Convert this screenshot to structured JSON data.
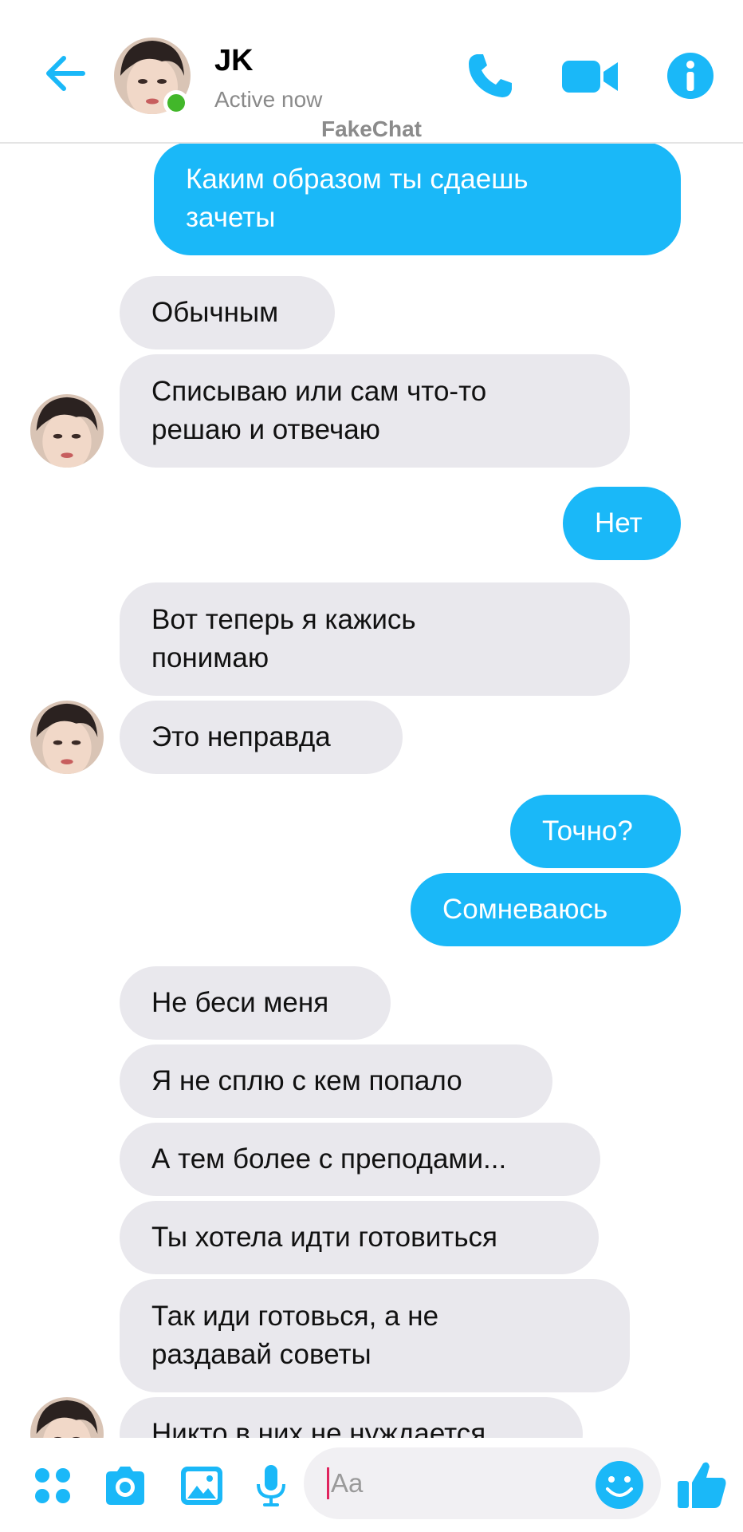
{
  "header": {
    "contact_name": "JK",
    "status": "Active now",
    "watermark": "FakeChat",
    "back_icon": "back-arrow-icon",
    "call_icon": "phone-icon",
    "video_icon": "video-camera-icon",
    "info_icon": "info-icon"
  },
  "colors": {
    "accent": "#1ab8f8",
    "incoming_bubble": "#e9e8ed",
    "active_dot": "#42b72a"
  },
  "messages": [
    {
      "dir": "out",
      "text": "Каким образом ты сдаешь\nзачеты"
    },
    {
      "dir": "in",
      "text": "Обычным"
    },
    {
      "dir": "in",
      "text": "Списываю или сам что-то\nрешаю и отвечаю",
      "avatar": true
    },
    {
      "dir": "out",
      "text": "Нет"
    },
    {
      "dir": "in",
      "text": "Вот теперь я кажись\nпонимаю"
    },
    {
      "dir": "in",
      "text": "Это неправда",
      "avatar": true
    },
    {
      "dir": "out",
      "text": "Точно?"
    },
    {
      "dir": "out",
      "text": "Сомневаюсь"
    },
    {
      "dir": "in",
      "text": "Не беси меня"
    },
    {
      "dir": "in",
      "text": "Я не сплю с кем попало"
    },
    {
      "dir": "in",
      "text": "А тем более с преподами..."
    },
    {
      "dir": "in",
      "text": "Ты хотела идти готовиться"
    },
    {
      "dir": "in",
      "text": "Так иди готовься, а не\nраздавай советы"
    },
    {
      "dir": "in",
      "text": "Никто в них не нуждается",
      "avatar": true
    }
  ],
  "composer": {
    "placeholder": "Aa",
    "icons": [
      "apps-icon",
      "camera-icon",
      "gallery-icon",
      "microphone-icon",
      "emoji-icon",
      "thumbs-up-icon"
    ]
  }
}
